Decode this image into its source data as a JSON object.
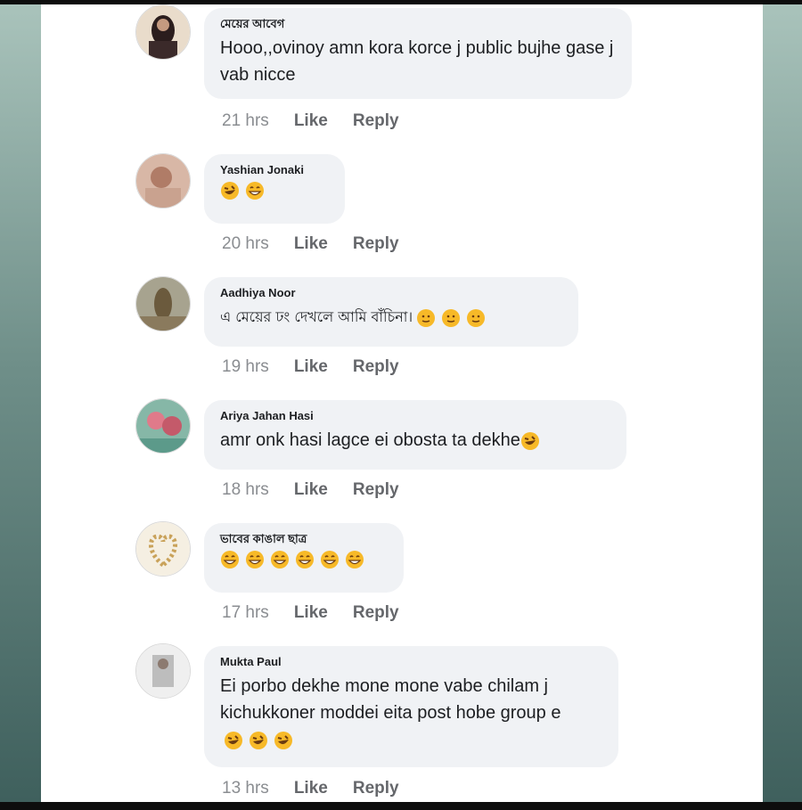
{
  "comments": [
    {
      "author": "মেয়ের আবেগ",
      "text": "Hooo,,ovinoy amn kora korce j public bujhe gase j vab nicce",
      "time": "21 hrs",
      "like": "Like",
      "reply": "Reply",
      "avatar_color": "#3b2a2a"
    },
    {
      "author": "Yashian Jonaki",
      "text": "",
      "emojis": [
        "rolling-laugh",
        "grin-sweat"
      ],
      "time": "20 hrs",
      "like": "Like",
      "reply": "Reply",
      "avatar_color": "#c9a28f"
    },
    {
      "author": "Aadhiya Noor",
      "text": "এ মেয়ের ঢং দেখলে আমি বাঁচিনা।",
      "emojis": [
        "slight-smile",
        "slight-smile",
        "slight-smile"
      ],
      "time": "19 hrs",
      "like": "Like",
      "reply": "Reply",
      "avatar_color": "#8a7a5d"
    },
    {
      "author": "Ariya Jahan Hasi",
      "text": "amr onk hasi lagce ei obosta ta dekhe",
      "emojis": [
        "rolling-laugh"
      ],
      "time": "18 hrs",
      "like": "Like",
      "reply": "Reply",
      "avatar_color": "#5c9a8a"
    },
    {
      "author": "ভাবের কাঙাল ছাত্র",
      "text": "",
      "emojis": [
        "grin-sweat",
        "grin-sweat",
        "grin-sweat",
        "grin-sweat",
        "grin-sweat",
        "grin-sweat"
      ],
      "time": "17 hrs",
      "like": "Like",
      "reply": "Reply",
      "avatar_color": "#e8dcc4"
    },
    {
      "author": "Mukta Paul",
      "text": "Ei porbo dekhe mone mone vabe chilam j kichukkoner moddei eita post hobe group e",
      "emojis": [
        "rolling-laugh",
        "rolling-laugh",
        "rolling-laugh"
      ],
      "time": "13 hrs",
      "like": "Like",
      "reply": "Reply",
      "avatar_color": "#d8d8d8"
    }
  ]
}
